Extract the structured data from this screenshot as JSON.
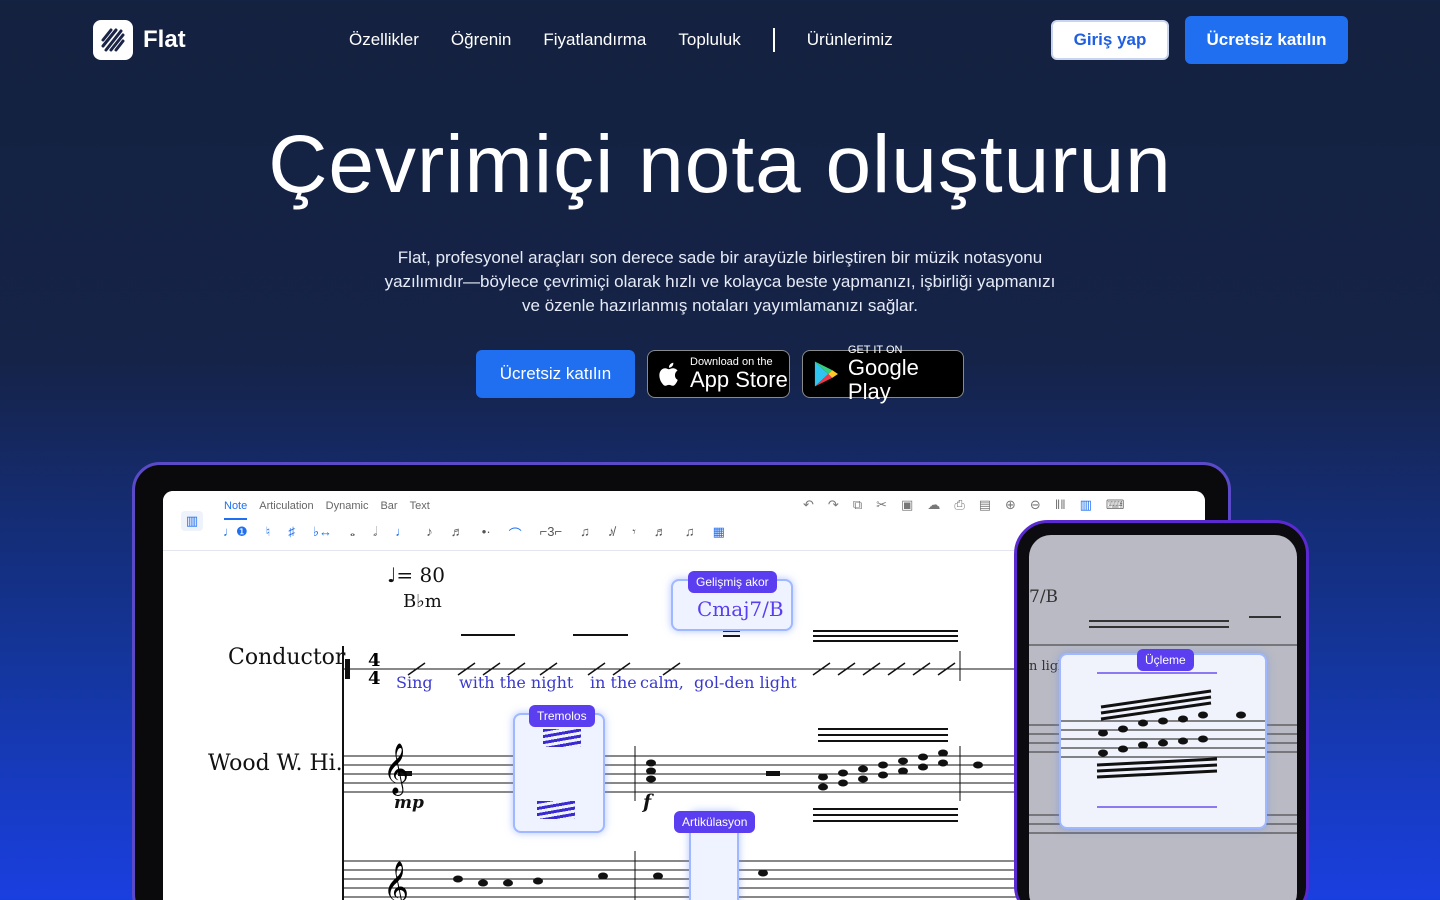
{
  "nav": {
    "brand": "Flat",
    "links": [
      "Özellikler",
      "Öğrenin",
      "Fiyatlandırma",
      "Topluluk",
      "Ürünlerimiz"
    ],
    "login_label": "Giriş yap",
    "join_label": "Ücretsiz katılın"
  },
  "hero": {
    "title": "Çevrimiçi nota oluşturun",
    "description": "Flat, profesyonel araçları son derece sade bir arayüzle birleştiren bir müzik notasyonu yazılımıdır—böylece çevrimiçi olarak hızlı ve kolayca beste yapmanızı, işbirliği yapmanızı ve özenle hazırlanmış notaları yayımlamanızı sağlar.",
    "cta_label": "Ücretsiz katılın",
    "appstore_small": "Download on the",
    "appstore_big": "App Store",
    "gplay_small": "GET IT ON",
    "gplay_big": "Google Play"
  },
  "editor": {
    "tabs": [
      "Note",
      "Articulation",
      "Dynamic",
      "Bar",
      "Text"
    ],
    "tempo": "♩= 80",
    "chord_bm": "B♭m",
    "parts": [
      "Conductor",
      "Wood W. Hi."
    ],
    "lyrics": [
      "Sing",
      "with the night",
      "in the",
      "calm,",
      "gol-den light"
    ],
    "dynamics": [
      "mp",
      "f"
    ],
    "tags": {
      "advanced_chord": "Gelişmiş akor",
      "tremolos": "Tremolos",
      "articulation": "Artikülasyon",
      "triplet": "Üçleme"
    },
    "chord_symbol": "Cmaj7/B",
    "phone_chord": "7/B",
    "phone_lyric": "n ligl"
  },
  "colors": {
    "accent": "#1f6ff0",
    "tag": "#5b3ef0",
    "background": "#14213f"
  }
}
